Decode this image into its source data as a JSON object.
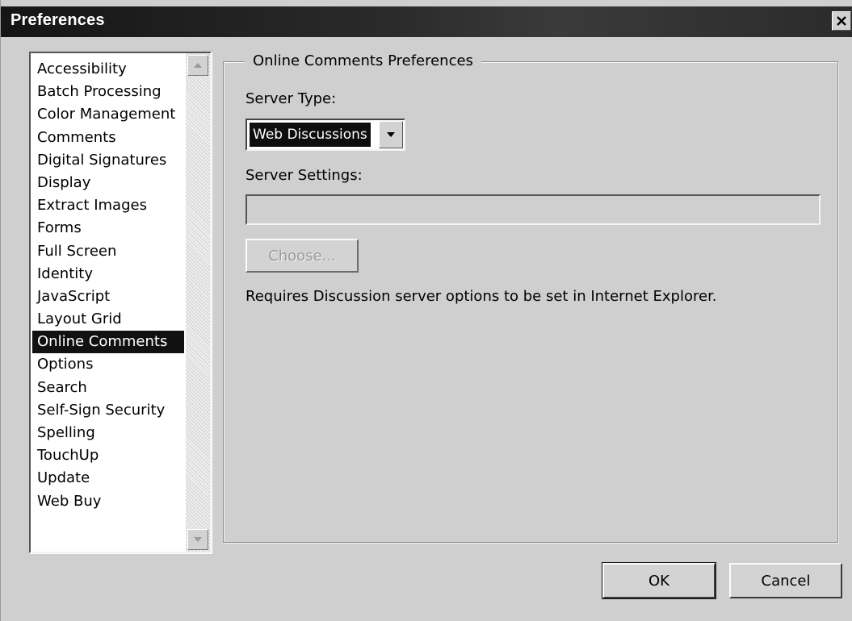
{
  "window": {
    "title": "Preferences"
  },
  "sidebar": {
    "selected": "Online Comments",
    "items": [
      "Accessibility",
      "Batch Processing",
      "Color Management",
      "Comments",
      "Digital Signatures",
      "Display",
      "Extract Images",
      "Forms",
      "Full Screen",
      "Identity",
      "JavaScript",
      "Layout Grid",
      "Online Comments",
      "Options",
      "Search",
      "Self-Sign Security",
      "Spelling",
      "TouchUp",
      "Update",
      "Web Buy"
    ]
  },
  "panel": {
    "group_title": "Online Comments Preferences",
    "server_type_label": "Server Type:",
    "server_type_value": "Web Discussions",
    "server_settings_label": "Server Settings:",
    "server_settings_value": "",
    "choose_label": "Choose...",
    "note": "Requires Discussion server options to be set in Internet Explorer."
  },
  "footer": {
    "ok_label": "OK",
    "cancel_label": "Cancel"
  },
  "icons": {
    "close": "close-icon",
    "scroll_up": "arrow-up-icon",
    "scroll_down": "arrow-down-icon",
    "dropdown": "chevron-down-icon"
  },
  "colors": {
    "selection": "#111111",
    "dialog_background": "#cfcfcf",
    "titlebar": "#1c1c1c"
  }
}
